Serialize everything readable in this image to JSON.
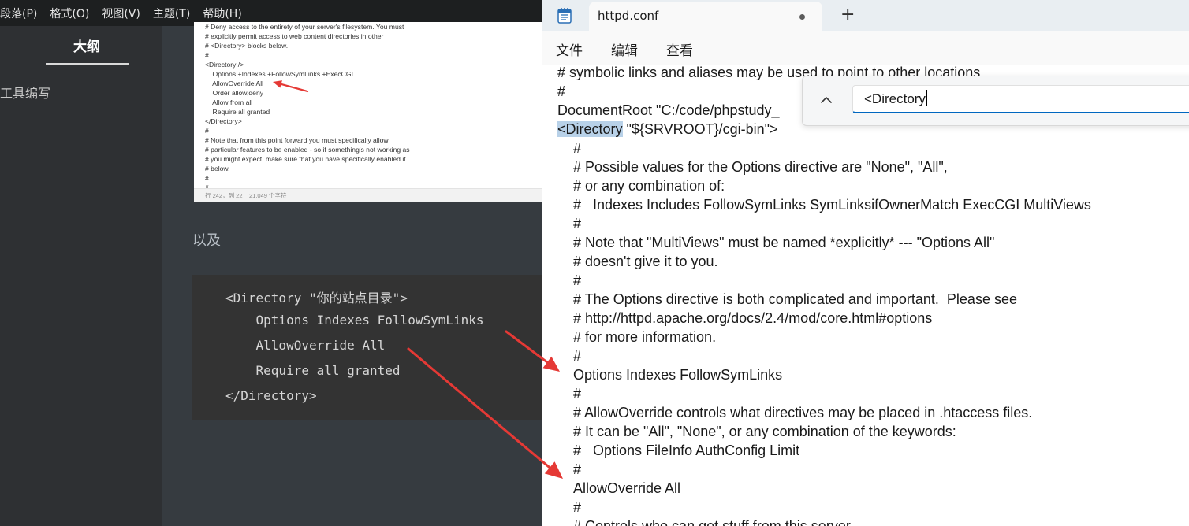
{
  "left_app": {
    "menu": [
      "段落(P)",
      "格式(O)",
      "视图(V)",
      "主题(T)",
      "帮助(H)"
    ],
    "sidebar": {
      "tab_label": "大纲",
      "item": "工具编写"
    },
    "screenshot": {
      "lines": [
        "# Deny access to the entirety of your server's filesystem. You must",
        "# explicitly permit access to web content directories in other",
        "# <Directory> blocks below.",
        "#",
        "<Directory />",
        "    Options +Indexes +FollowSymLinks +ExecCGI",
        "    AllowOverride All",
        "    Order allow,deny",
        "    Allow from all",
        "    Require all granted",
        "</Directory>",
        "#",
        "# Note that from this point forward you must specifically allow",
        "# particular features to be enabled - so if something's not working as",
        "# you might expect, make sure that you have specifically enabled it",
        "# below.",
        "#",
        "#"
      ],
      "status_position": "行 242，列 22",
      "status_count": "21,049 个字符"
    },
    "paragraph": "以及",
    "code_lines": [
      "<Directory \"你的站点目录\">",
      "    Options Indexes FollowSymLinks",
      "    AllowOverride All",
      "    Require all granted",
      "</Directory>"
    ]
  },
  "notepad": {
    "tab_title": "httpd.conf",
    "new_tab_glyph": "+",
    "menu": [
      "文件",
      "编辑",
      "查看"
    ],
    "find_text": "<Directory",
    "lines": [
      {
        "text": "# symbolic links and aliases may be used to point to other locations.",
        "indent": false
      },
      {
        "text": "#",
        "indent": false
      },
      {
        "text": "DocumentRoot \"C:/code/phpstudy_",
        "indent": false
      },
      {
        "text": "\"${SRVROOT}/cgi-bin\">",
        "indent": false,
        "highlight": "<Directory"
      },
      {
        "text": "#",
        "indent": true
      },
      {
        "text": "# Possible values for the Options directive are \"None\", \"All\",",
        "indent": true
      },
      {
        "text": "# or any combination of:",
        "indent": true
      },
      {
        "text": "#   Indexes Includes FollowSymLinks SymLinksifOwnerMatch ExecCGI MultiViews",
        "indent": true
      },
      {
        "text": "#",
        "indent": true
      },
      {
        "text": "# Note that \"MultiViews\" must be named *explicitly* --- \"Options All\"",
        "indent": true
      },
      {
        "text": "# doesn't give it to you.",
        "indent": true
      },
      {
        "text": "#",
        "indent": true
      },
      {
        "text": "# The Options directive is both complicated and important.  Please see",
        "indent": true
      },
      {
        "text": "# http://httpd.apache.org/docs/2.4/mod/core.html#options",
        "indent": true
      },
      {
        "text": "# for more information.",
        "indent": true
      },
      {
        "text": "#",
        "indent": true
      },
      {
        "text": "Options Indexes FollowSymLinks",
        "indent": true
      },
      {
        "text": "#",
        "indent": true
      },
      {
        "text": "# AllowOverride controls what directives may be placed in .htaccess files.",
        "indent": true
      },
      {
        "text": "# It can be \"All\", \"None\", or any combination of the keywords:",
        "indent": true
      },
      {
        "text": "#   Options FileInfo AuthConfig Limit",
        "indent": true
      },
      {
        "text": "#",
        "indent": true
      },
      {
        "text": "AllowOverride All",
        "indent": true
      },
      {
        "text": "#",
        "indent": true
      },
      {
        "text": "# Controls who can get stuff from this server.",
        "indent": true
      }
    ]
  },
  "colors": {
    "annotation_arrow": "#e53935",
    "selection_highlight": "#b8d1e8",
    "find_accent": "#0067c0"
  }
}
